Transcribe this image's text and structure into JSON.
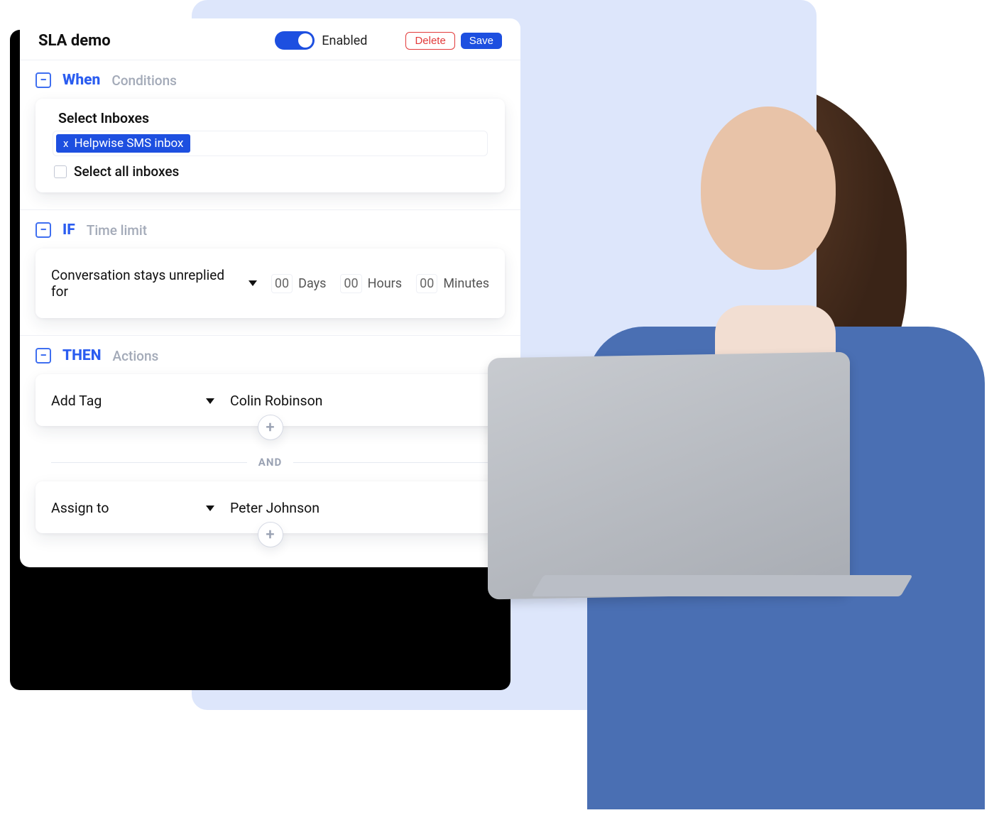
{
  "header": {
    "title": "SLA demo",
    "enabled_label": "Enabled",
    "delete_label": "Delete",
    "save_label": "Save"
  },
  "when": {
    "title": "When",
    "subtitle": "Conditions",
    "select_inboxes_label": "Select Inboxes",
    "chip_x": "x",
    "chip_label": "Helpwise SMS inbox",
    "select_all_label": "Select all inboxes"
  },
  "if": {
    "title": "IF",
    "subtitle": "Time limit",
    "condition_label": "Conversation stays unreplied for",
    "days_val": "00",
    "days_label": "Days",
    "hours_val": "00",
    "hours_label": "Hours",
    "minutes_val": "00",
    "minutes_label": "Minutes"
  },
  "then": {
    "title": "THEN",
    "subtitle": "Actions",
    "action1_type": "Add Tag",
    "action1_value": "Colin Robinson",
    "and_label": "AND",
    "action2_type": "Assign to",
    "action2_value": "Peter Johnson",
    "plus_label": "+"
  }
}
